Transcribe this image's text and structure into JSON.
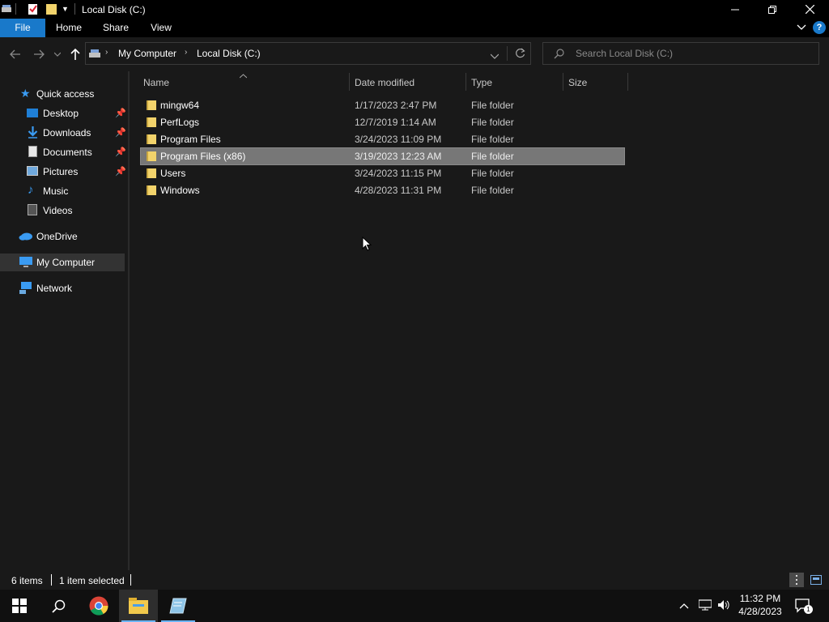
{
  "window": {
    "title": "Local Disk (C:)"
  },
  "ribbon": {
    "tabs": [
      "File",
      "Home",
      "Share",
      "View"
    ]
  },
  "address": {
    "crumbs": [
      "My Computer",
      "Local Disk (C:)"
    ]
  },
  "search": {
    "placeholder": "Search Local Disk (C:)"
  },
  "nav": {
    "quick_access": "Quick access",
    "items": [
      "Desktop",
      "Downloads",
      "Documents",
      "Pictures",
      "Music",
      "Videos"
    ],
    "onedrive": "OneDrive",
    "mycomputer": "My Computer",
    "network": "Network"
  },
  "columns": [
    "Name",
    "Date modified",
    "Type",
    "Size"
  ],
  "files": [
    {
      "name": "mingw64",
      "date": "1/17/2023 2:47 PM",
      "type": "File folder"
    },
    {
      "name": "PerfLogs",
      "date": "12/7/2019 1:14 AM",
      "type": "File folder"
    },
    {
      "name": "Program Files",
      "date": "3/24/2023 11:09 PM",
      "type": "File folder"
    },
    {
      "name": "Program Files (x86)",
      "date": "3/19/2023 12:23 AM",
      "type": "File folder",
      "selected": true
    },
    {
      "name": "Users",
      "date": "3/24/2023 11:15 PM",
      "type": "File folder"
    },
    {
      "name": "Windows",
      "date": "4/28/2023 11:31 PM",
      "type": "File folder"
    }
  ],
  "status": {
    "count": "6 items",
    "selected": "1 item selected"
  },
  "taskbar": {
    "time": "11:32 PM",
    "date": "4/28/2023",
    "notification_count": "1"
  },
  "colors": {
    "accent": "#1979ca",
    "selection": "#777777",
    "folder": "#f2d36b"
  }
}
